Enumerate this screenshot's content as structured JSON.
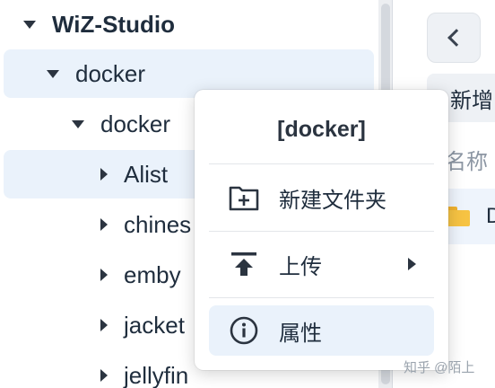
{
  "tree": {
    "items": [
      {
        "label": "WiZ-Studio",
        "expanded": true
      },
      {
        "label": "docker",
        "expanded": true
      },
      {
        "label": "docker",
        "expanded": true
      },
      {
        "label": "Alist",
        "expanded": false
      },
      {
        "label": "chines",
        "expanded": false
      },
      {
        "label": "emby",
        "expanded": false
      },
      {
        "label": "jacket",
        "expanded": false
      },
      {
        "label": "jellyfin",
        "expanded": false
      }
    ]
  },
  "toolbar": {
    "new_label": "新增"
  },
  "file_list": {
    "column_name": "名称",
    "rows": [
      {
        "name": "D"
      }
    ]
  },
  "context_menu": {
    "title": "[docker]",
    "items": [
      {
        "label": "新建文件夹",
        "icon": "new-folder-icon"
      },
      {
        "label": "上传",
        "icon": "upload-icon",
        "has_submenu": true
      },
      {
        "label": "属性",
        "icon": "info-icon"
      }
    ]
  },
  "watermark": "知乎 @陌上",
  "colors": {
    "selection": "#eaf2fb",
    "folder": "#f6c343",
    "text": "#1f2d3d"
  }
}
